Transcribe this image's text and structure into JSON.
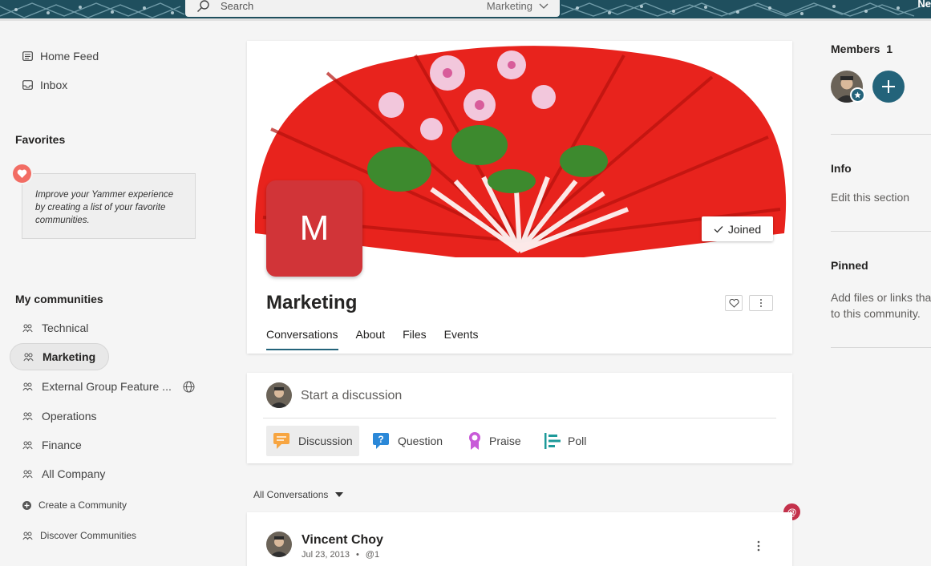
{
  "header": {
    "search_placeholder": "Search",
    "search_scope": "Marketing",
    "new_label": "Ne"
  },
  "leftnav": {
    "home_feed": "Home Feed",
    "inbox": "Inbox",
    "favorites_title": "Favorites",
    "favorites_hint": "Improve your Yammer experience by creating a list of your favorite communities.",
    "my_communities_title": "My communities",
    "communities": [
      {
        "label": "Technical"
      },
      {
        "label": "Marketing"
      },
      {
        "label": "External Group Feature ..."
      },
      {
        "label": "Operations"
      },
      {
        "label": "Finance"
      },
      {
        "label": "All Company"
      }
    ],
    "create_community": "Create a Community",
    "discover_communities": "Discover Communities"
  },
  "group": {
    "avatar_letter": "M",
    "name": "Marketing",
    "joined_label": "Joined",
    "tabs": [
      {
        "label": "Conversations",
        "active": true
      },
      {
        "label": "About"
      },
      {
        "label": "Files"
      },
      {
        "label": "Events"
      }
    ]
  },
  "composer": {
    "placeholder": "Start a discussion",
    "types": [
      {
        "label": "Discussion",
        "icon": "discussion-icon",
        "color": "#f7a541"
      },
      {
        "label": "Question",
        "icon": "question-icon",
        "color": "#2b88d8"
      },
      {
        "label": "Praise",
        "icon": "praise-icon",
        "color": "#c85ad8"
      },
      {
        "label": "Poll",
        "icon": "poll-icon",
        "color": "#1d9a9a"
      }
    ]
  },
  "feed": {
    "filter_label": "All Conversations",
    "mention_badge": "@",
    "post": {
      "author": "Vincent Choy",
      "date": "Jul 23, 2013",
      "mention": "@1"
    }
  },
  "right": {
    "members_title": "Members",
    "members_count": "1",
    "info_title": "Info",
    "info_text": "Edit this section",
    "pinned_title": "Pinned",
    "pinned_text_1": "Add files or links tha",
    "pinned_text_2": "to this community."
  },
  "colors": {
    "brand": "#23637a",
    "group_avatar": "#d13438",
    "header": "#1f4f5e"
  }
}
